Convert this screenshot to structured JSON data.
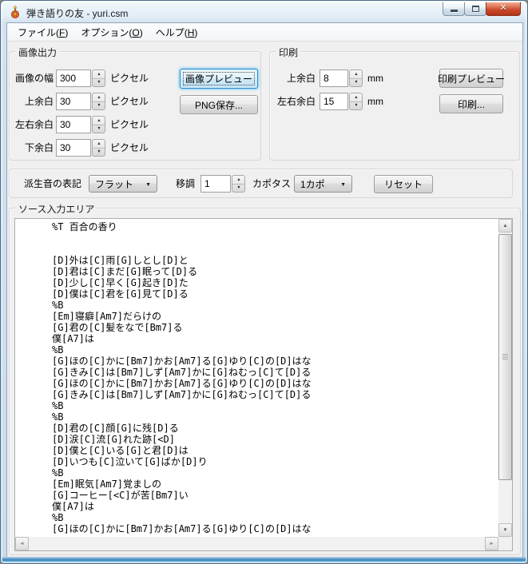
{
  "window": {
    "title": "弾き語りの友 - yuri.csm"
  },
  "titlebar_buttons": {
    "minimize": "minimize",
    "maximize": "maximize",
    "close": "close"
  },
  "menu": {
    "items": [
      {
        "label": "ファイル(F)"
      },
      {
        "label": "オプション(O)"
      },
      {
        "label": "ヘルプ(H)"
      }
    ]
  },
  "image_output": {
    "title": "画像出力",
    "fields": [
      {
        "label": "画像の幅",
        "value": "300",
        "unit": "ピクセル"
      },
      {
        "label": "上余白",
        "value": "30",
        "unit": "ピクセル"
      },
      {
        "label": "左右余白",
        "value": "30",
        "unit": "ピクセル"
      },
      {
        "label": "下余白",
        "value": "30",
        "unit": "ピクセル"
      }
    ],
    "preview_button": "画像プレビュー",
    "save_png_button": "PNG保存..."
  },
  "print": {
    "title": "印刷",
    "fields": [
      {
        "label": "上余白",
        "value": "8",
        "unit": "mm"
      },
      {
        "label": "左右余白",
        "value": "15",
        "unit": "mm"
      }
    ],
    "preview_button": "印刷プレビュー",
    "print_button": "印刷..."
  },
  "options": {
    "accidental_label": "派生音の表記",
    "accidental_value": "フラット",
    "transpose_label": "移調",
    "transpose_value": "1",
    "capo_label": "カポタスト",
    "capo_value": "1カポ",
    "reset_button": "リセット"
  },
  "source": {
    "title": "ソース入力エリア",
    "text": "%T 百合の香り\n\n\n[D]外は[C]雨[G]しとし[D]と\n[D]君は[C]まだ[G]眠って[D]る\n[D]少し[C]早く[G]起き[D]た\n[D]僕は[C]君を[G]見て[D]る\n%B\n[Em]寝癖[Am7]だらけの\n[G]君の[C]髪をなで[Bm7]る\n僕[A7]は\n%B\n[G]ほの[C]かに[Bm7]かお[Am7]る[G]ゆり[C]の[D]はな\n[G]きみ[C]は[Bm7]しず[Am7]かに[G]ねむっ[C]て[D]る\n[G]ほの[C]かに[Bm7]かお[Am7]る[G]ゆり[C]の[D]はな\n[G]きみ[C]は[Bm7]しず[Am7]かに[G]ねむっ[C]て[D]る\n%B\n%B\n[D]君の[C]顔[G]に残[D]る\n[D]涙[C]流[G]れた跡[<D]\n[D]僕と[C]いる[G]と君[D]は\n[D]いつも[C]泣いて[G]ばか[D]り\n%B\n[Em]眠気[Am7]覚ましの\n[G]コーヒー[<C]が苦[Bm7]い\n僕[A7]は\n%B\n[G]ほの[C]かに[Bm7]かお[Am7]る[G]ゆり[C]の[D]はな"
  },
  "icons": {
    "app_icon": "guitar",
    "combo_arrow": "▼",
    "spin_up": "▲",
    "spin_down": "▼",
    "scroll_up": "▲",
    "scroll_down": "▼",
    "scroll_left": "◄",
    "scroll_right": "►",
    "close": "✕"
  },
  "colors": {
    "client_bg": "#f0f0f0",
    "frame": "#cddfee",
    "close_button": "#cc4a2d",
    "focus_border": "#2c8ccc",
    "focus_glow": "#82cdf2"
  }
}
